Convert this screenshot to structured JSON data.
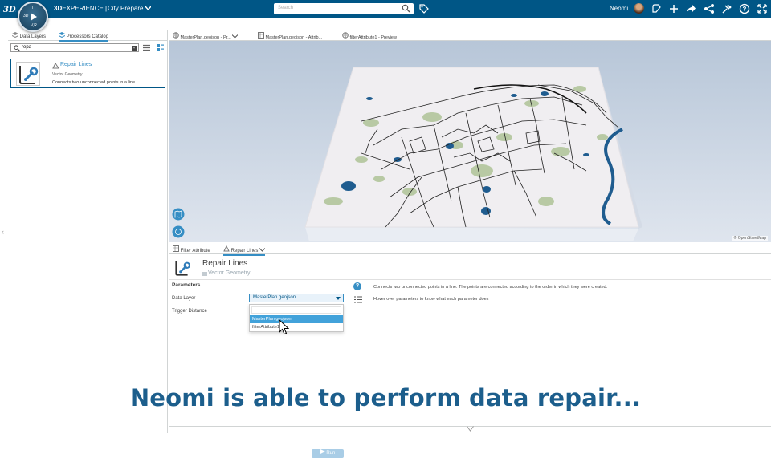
{
  "topbar": {
    "brand_bold": "3D",
    "brand_rest": "EXPERIENCE",
    "separator": "|",
    "app_name": "City Prepare",
    "search_placeholder": "Search",
    "user_name": "Neomi",
    "compass": {
      "top_label": "i",
      "left_label": "3D",
      "bottom_label": "V,R"
    },
    "icons": [
      "ds-logo-icon",
      "compass-icon",
      "search-icon",
      "tag-icon",
      "avatar",
      "lifecycle-icon",
      "add-icon",
      "share-icon",
      "network-icon",
      "tools-icon",
      "help-icon",
      "fullscreen-icon"
    ]
  },
  "left_panel": {
    "tabs": [
      {
        "label": "Data Layers",
        "active": false
      },
      {
        "label": "Processors Catalog",
        "active": true
      }
    ],
    "search_value": "repa",
    "result": {
      "title": "Repair Lines",
      "category": "Vector Geometry",
      "description": "Connects two unconnected points in a line."
    }
  },
  "viewer": {
    "tabs": [
      {
        "label": "MasterPlan.geojson - Pr...",
        "active": true
      },
      {
        "label": "MasterPlan.geojson - Attrib...",
        "active": false
      },
      {
        "label": "filterAttribute1 - Preview",
        "active": false
      }
    ],
    "attribution": "© OpenStreetMap"
  },
  "bottom_panel": {
    "tabs": [
      {
        "label": "Filter Attribute",
        "active": false
      },
      {
        "label": "Repair Lines",
        "active": true
      }
    ],
    "processor_title": "Repair Lines",
    "processor_category": "Vector Geometry",
    "parameters_header": "Parameters",
    "param_labels": [
      "Data Layer",
      "Trigger Distance"
    ],
    "data_layer_value": "MasterPlan.geojson",
    "dropdown_options": [
      {
        "label": "MasterPlan.geojson",
        "selected": true
      },
      {
        "label": "filterAttribute1",
        "selected": false
      }
    ],
    "info_lines": [
      "Connects two unconnected points in a line. The points are connected according to the order in which they were created.",
      "Hover over parameters to know what each parameter does"
    ],
    "run_label": "Run"
  },
  "caption": "Neomi is able to perform data repair...",
  "colors": {
    "topbar": "#005686",
    "accent": "#368ec4",
    "selected_option": "#42a2da",
    "caption": "#1c5e8c",
    "water": "#1f5c8f",
    "parks": "#b8c9a4"
  }
}
